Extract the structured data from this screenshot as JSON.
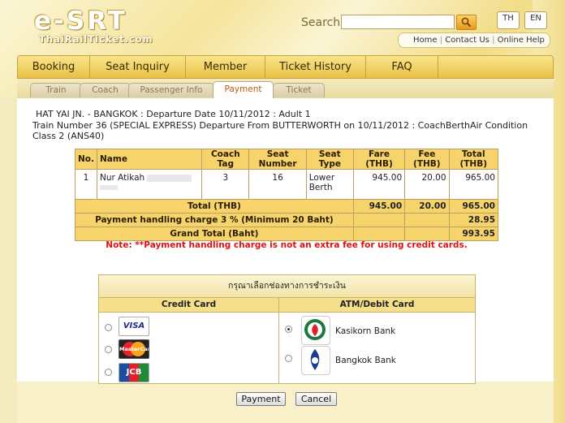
{
  "header": {
    "logo_main": "e-SRT",
    "logo_sub": "ThaiRailTicket.com",
    "search_label": "Search",
    "search_placeholder": "",
    "lang": [
      "TH",
      "EN"
    ],
    "links": [
      "Home",
      "Contact Us",
      "Online Help"
    ]
  },
  "nav": [
    "Booking",
    "Seat Inquiry",
    "Member",
    "Ticket History",
    "FAQ"
  ],
  "steps": [
    "Train",
    "Coach",
    "Passenger Info",
    "Payment",
    "Ticket"
  ],
  "active_step": "Payment",
  "trip": {
    "line1": "HAT YAI JN. - BANGKOK : Departure Date 10/11/2012 : Adult 1",
    "line2": "Train Number 36 (SPECIAL EXPRESS) Departure From BUTTERWORTH on 10/11/2012 : CoachBerthAir Condition Class 2 (ANS40)"
  },
  "table": {
    "headers": [
      "No.",
      "Name",
      "Coach Tag",
      "Seat Number",
      "Seat Type",
      "Fare (THB)",
      "Fee (THB)",
      "Total (THB)"
    ],
    "rows": [
      {
        "no": "1",
        "name": "Nur Atikah",
        "coach": "3",
        "seat": "16",
        "type": "Lower Berth",
        "fare": "945.00",
        "fee": "20.00",
        "total": "965.00"
      }
    ],
    "total_label": "Total (THB)",
    "total_fare": "945.00",
    "total_fee": "20.00",
    "total_total": "965.00",
    "handling_label": "Payment handling charge 3 % (Minimum 20 Baht)",
    "handling_value": "28.95",
    "grand_label": "Grand Total (Baht)",
    "grand_value": "993.95"
  },
  "note": "Note: **Payment handling charge is not an extra fee for using credit cards.",
  "payment": {
    "heading": "กรุณาเลือกช่องทางการชำระเงิน",
    "credit_label": "Credit Card",
    "atm_label": "ATM/Debit Card",
    "cards": [
      "VISA",
      "MasterCard",
      "JCB"
    ],
    "banks": [
      "Kasikorn Bank",
      "Bangkok Bank"
    ],
    "selected": "Kasikorn Bank"
  },
  "buttons": {
    "pay": "Payment",
    "cancel": "Cancel"
  },
  "colors": {
    "nav_gold": "#e9c145",
    "table_header": "#f6d36b",
    "note_red": "#e01010",
    "kbank_green": "#1a7a3a",
    "bbl_blue": "#1b3e8c"
  }
}
